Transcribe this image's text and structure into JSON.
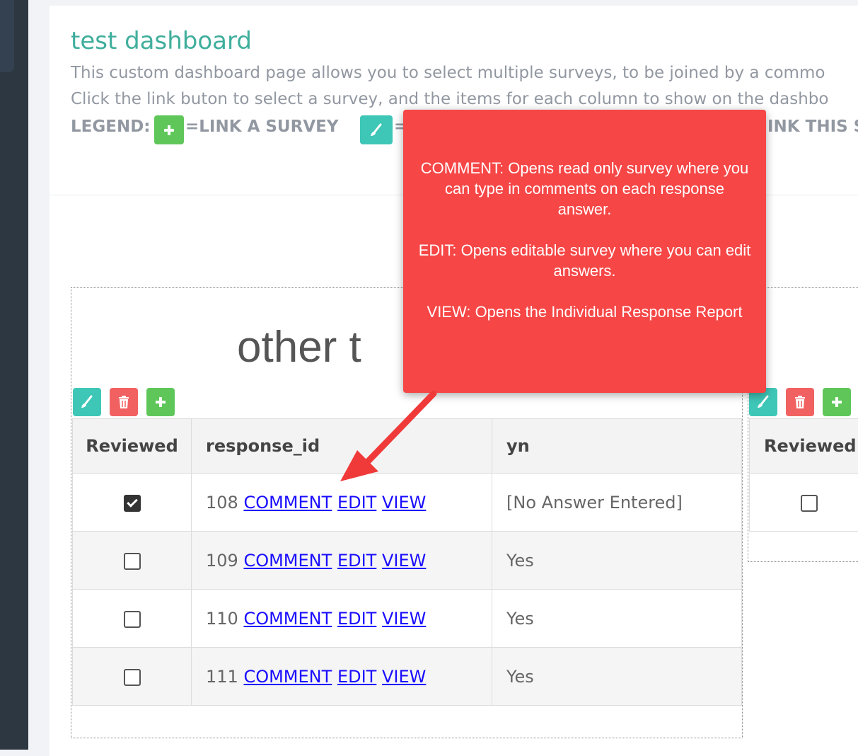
{
  "page": {
    "title": "test dashboard",
    "description_line1": "This custom dashboard page allows you to select multiple surveys, to be joined by a commo",
    "description_line2": "Click the link buton to select a survey, and the items for each column to show on the dashbo",
    "legend": {
      "label": "LEGEND:",
      "link_text": "=LINK A SURVEY",
      "edit_text": "=",
      "unlink_text": "INK THIS S"
    }
  },
  "panel_left": {
    "title": "other t",
    "columns": [
      "Reviewed",
      "response_id",
      "yn"
    ],
    "rows": [
      {
        "reviewed": true,
        "response_id": "108",
        "comment": "COMMENT",
        "edit": "EDIT",
        "view": "VIEW",
        "yn": "[No Answer Entered]"
      },
      {
        "reviewed": false,
        "response_id": "109",
        "comment": "COMMENT",
        "edit": "EDIT",
        "view": "VIEW",
        "yn": "Yes"
      },
      {
        "reviewed": false,
        "response_id": "110",
        "comment": "COMMENT",
        "edit": "EDIT",
        "view": "VIEW",
        "yn": "Yes"
      },
      {
        "reviewed": false,
        "response_id": "111",
        "comment": "COMMENT",
        "edit": "EDIT",
        "view": "VIEW",
        "yn": "Yes"
      }
    ]
  },
  "panel_right": {
    "columns": [
      "Reviewed"
    ],
    "rows": [
      {
        "reviewed": false
      }
    ]
  },
  "tooltip": {
    "comment": "COMMENT:  Opens read only survey where you can type in comments on each response answer.",
    "edit": "EDIT:  Opens editable survey where you can edit answers.",
    "view": "VIEW:  Opens the Individual Response Report"
  },
  "colors": {
    "accent": "#3fae9c",
    "tooltip_bg": "#f64646",
    "link": "#1a0dff",
    "edit_button": "#3ec6b7",
    "delete_button": "#f26161",
    "add_button": "#5fc75a"
  },
  "icons": {
    "edit": "brush-icon",
    "delete": "trash-icon",
    "add": "plus-icon"
  }
}
